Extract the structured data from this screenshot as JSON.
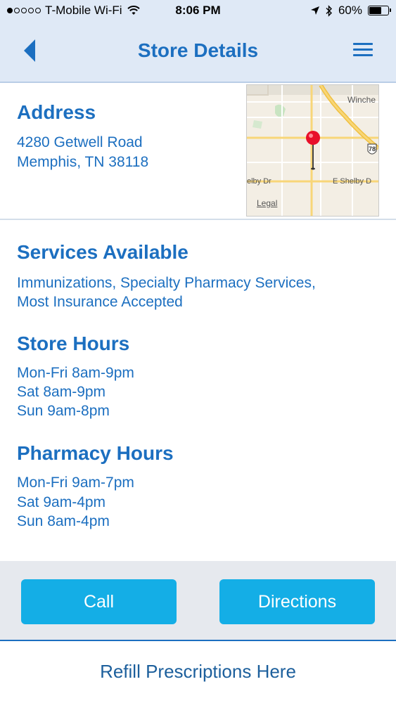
{
  "status_bar": {
    "carrier": "T-Mobile Wi-Fi",
    "time": "8:06 PM",
    "battery": "60%",
    "battery_level": 0.6,
    "icons": [
      "signal-dots-icon",
      "wifi-icon",
      "location-arrow-icon",
      "bluetooth-icon",
      "battery-icon"
    ]
  },
  "nav": {
    "title": "Store Details",
    "icons": [
      "back-chevron-icon",
      "hamburger-menu-icon"
    ]
  },
  "address": {
    "heading": "Address",
    "line1": "4280 Getwell Road",
    "line2": "Memphis, TN 38118",
    "map": {
      "label_top": "Winche",
      "label_left": "elby Dr",
      "label_right": "E Shelby D",
      "highway": "78",
      "legal": "Legal"
    }
  },
  "services": {
    "heading": "Services Available",
    "line1": "Immunizations, Specialty Pharmacy Services,",
    "line2": "Most Insurance Accepted"
  },
  "store_hours": {
    "heading": "Store Hours",
    "lines": [
      "Mon-Fri 8am-9pm",
      "Sat 8am-9pm",
      "Sun 9am-8pm"
    ]
  },
  "pharmacy_hours": {
    "heading": "Pharmacy Hours",
    "lines": [
      "Mon-Fri 9am-7pm",
      "Sat 9am-4pm",
      "Sun 8am-4pm"
    ]
  },
  "actions": {
    "call_label": "Call",
    "directions_label": "Directions"
  },
  "footer": {
    "refill_label": "Refill Prescriptions Here"
  },
  "colors": {
    "accent_blue": "#1c6fc0",
    "button_blue": "#14aee6",
    "nav_bg": "#dfe9f6",
    "pin_red": "#e8102a"
  }
}
